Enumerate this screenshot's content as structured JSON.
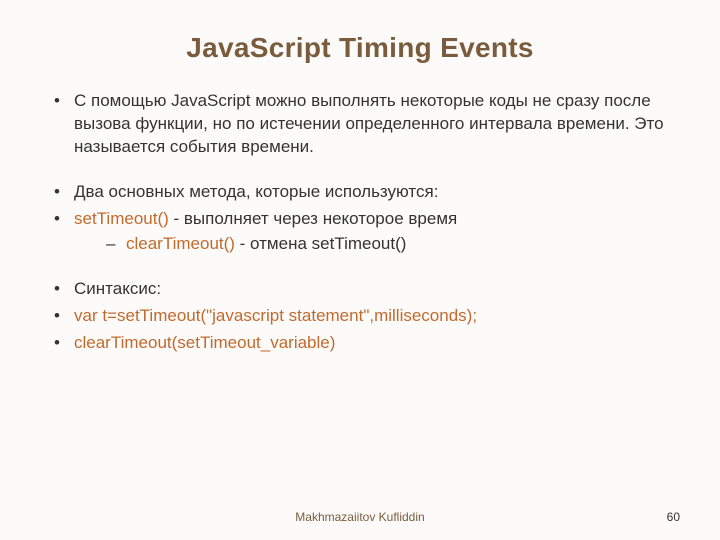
{
  "title": "JavaScript Timing Events",
  "b1": "С помощью JavaScript можно выполнять некоторые коды не сразу после вызова функции, но по истечении определенного интервала времени. Это называется события времени.",
  "b2": "Два основных метода, которые используются:",
  "b3a": "setTimeout()",
  "b3b": " - выполняет через некоторое время",
  "s1a": "clearTimeout()",
  "s1b": " - отмена setTimeout()",
  "b4": "Синтаксис:",
  "b5": "var t=setTimeout(\"javascript statement\",milliseconds);",
  "b6": "clearTimeout(setTimeout_variable)",
  "author": "Makhmazaiitov Kufliddin",
  "page": "60"
}
